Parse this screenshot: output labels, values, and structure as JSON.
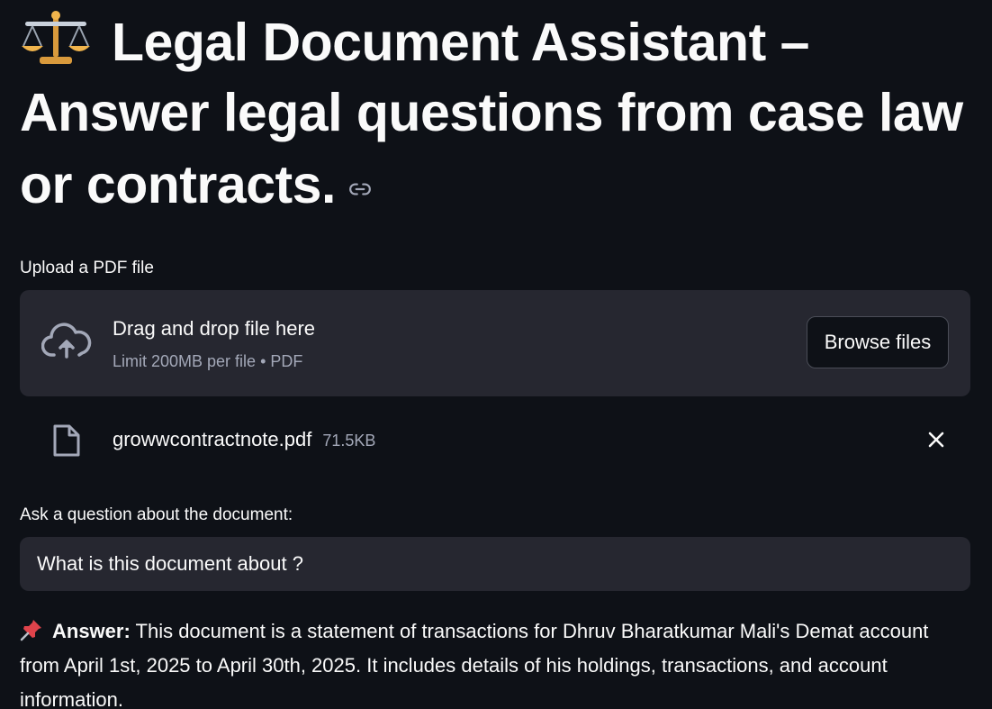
{
  "header": {
    "emoji": "balance-scale-icon",
    "title": "Legal Document Assistant – Answer legal questions from case law or contracts."
  },
  "uploader": {
    "label": "Upload a PDF file",
    "dropzone_text": "Drag and drop file here",
    "limit_text": "Limit 200MB per file • PDF",
    "browse_label": "Browse files",
    "file": {
      "name": "growwcontractnote.pdf",
      "size": "71.5KB"
    }
  },
  "question": {
    "label": "Ask a question about the document:",
    "value": "What is this document about ?"
  },
  "answer": {
    "prefix": "Answer:",
    "text": "This document is a statement of transactions for Dhruv Bharatkumar Mali's Demat account from April 1st, 2025 to April 30th, 2025. It includes details of his holdings, transactions, and account information."
  },
  "colors": {
    "background": "#0e1117",
    "surface": "#262730",
    "text": "#fafafa",
    "muted": "#a3a8b8"
  }
}
